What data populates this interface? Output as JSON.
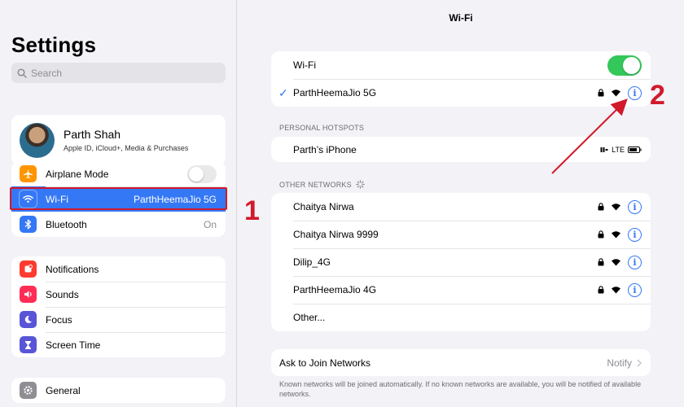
{
  "sidebar": {
    "title": "Settings",
    "search_placeholder": "Search",
    "profile": {
      "name": "Parth Shah",
      "subtitle": "Apple ID, iCloud+, Media & Purchases"
    },
    "group1": [
      {
        "label": "Airplane Mode",
        "icon": "airplane-icon",
        "color": "#ff9500",
        "toggle": "off"
      },
      {
        "label": "Wi-Fi",
        "icon": "wifi-icon",
        "color": "#3478f6",
        "value": "ParthHeemaJio 5G",
        "selected": true
      },
      {
        "label": "Bluetooth",
        "icon": "bluetooth-icon",
        "color": "#3478f6",
        "value": "On"
      }
    ],
    "group2": [
      {
        "label": "Notifications",
        "icon": "bell-icon",
        "color": "#ff3b30"
      },
      {
        "label": "Sounds",
        "icon": "speaker-icon",
        "color": "#ff2d55"
      },
      {
        "label": "Focus",
        "icon": "moon-icon",
        "color": "#5856d6"
      },
      {
        "label": "Screen Time",
        "icon": "hourglass-icon",
        "color": "#5856d6"
      }
    ],
    "group3": [
      {
        "label": "General",
        "icon": "gear-icon",
        "color": "#8e8e93"
      }
    ]
  },
  "main": {
    "title": "Wi-Fi",
    "wifi_toggle_label": "Wi-Fi",
    "wifi_toggle": "on",
    "connected_network": "ParthHeemaJio 5G",
    "hotspots_label": "PERSONAL HOTSPOTS",
    "hotspot": {
      "name": "Parth’s iPhone",
      "signal": "LTE"
    },
    "other_networks_label": "OTHER NETWORKS",
    "networks": [
      "Chaitya Nirwa",
      "Chaitya Nirwa 9999",
      "Dilip_4G",
      "ParthHeemaJio 4G"
    ],
    "other_label": "Other...",
    "ask_join_label": "Ask to Join Networks",
    "ask_join_value": "Notify",
    "footnote": "Known networks will be joined automatically. If no known networks are available, you will be notified of available networks."
  },
  "annotations": {
    "step1": "1",
    "step2": "2",
    "color": "#d11a2a"
  }
}
